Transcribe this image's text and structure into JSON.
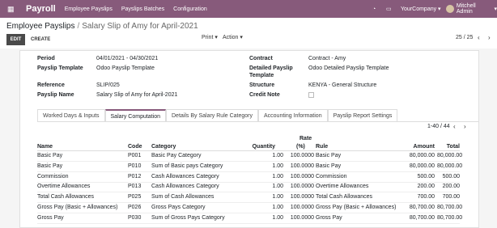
{
  "navbar": {
    "brand": "Payroll",
    "menu": [
      "Employee Payslips",
      "Payslips Batches",
      "Configuration"
    ],
    "company": "YourCompany",
    "user": "Mitchell Admin"
  },
  "breadcrumb": {
    "parent": "Employee Payslips",
    "current": "Salary Slip of Amy for April-2021"
  },
  "toolbar": {
    "edit": "EDIT",
    "create": "CREATE",
    "print": "Print",
    "action": "Action",
    "pager": "25 / 25"
  },
  "form": {
    "period_label": "Period",
    "period": "04/01/2021 - 04/30/2021",
    "template_label": "Payslip Template",
    "template": "Odoo Payslip Template",
    "reference_label": "Reference",
    "reference": "SLIP/025",
    "name_label": "Payslip Name",
    "name": "Salary Slip of Amy for April-2021",
    "contract_label": "Contract",
    "contract": "Contract - Amy",
    "detailed_label_1": "Detailed Payslip",
    "detailed_label_2": "Template",
    "detailed": "Odoo Detailed Payslip Template",
    "structure_label": "Structure",
    "structure": "KENYA - General Structure",
    "credit_label": "Credit Note"
  },
  "tabs": [
    "Worked Days & Inputs",
    "Salary Computation",
    "Details By Salary Rule Category",
    "Accounting Information",
    "Payslip Report Settings"
  ],
  "table": {
    "pager": "1-40 / 44",
    "headers": {
      "name": "Name",
      "code": "Code",
      "category": "Category",
      "quantity": "Quantity",
      "rate_1": "Rate",
      "rate_2": "(%)",
      "rule": "Rule",
      "amount": "Amount",
      "total": "Total"
    },
    "rows": [
      {
        "name": "Basic Pay",
        "code": "P001",
        "category": "Basic Pay Category",
        "quantity": "1.00",
        "rate": "100.0000",
        "rule": "Basic Pay",
        "amount": "80,000.00",
        "total": "80,000.00"
      },
      {
        "name": "Basic Pay",
        "code": "P010",
        "category": "Sum of Basic pays Category",
        "quantity": "1.00",
        "rate": "100.0000",
        "rule": "Basic Pay",
        "amount": "80,000.00",
        "total": "80,000.00"
      },
      {
        "name": "Commission",
        "code": "P012",
        "category": "Cash Allowances Category",
        "quantity": "1.00",
        "rate": "100.0000",
        "rule": "Commission",
        "amount": "500.00",
        "total": "500.00"
      },
      {
        "name": "Overtime Allowances",
        "code": "P013",
        "category": "Cash Allowances Category",
        "quantity": "1.00",
        "rate": "100.0000",
        "rule": "Overtime Allowances",
        "amount": "200.00",
        "total": "200.00"
      },
      {
        "name": "Total Cash Allowances",
        "code": "P025",
        "category": "Sum of Cash Allowances",
        "quantity": "1.00",
        "rate": "100.0000",
        "rule": "Total Cash Allowances",
        "amount": "700.00",
        "total": "700.00"
      },
      {
        "name": "Gross Pay (Basic + Allowances)",
        "code": "P026",
        "category": "Gross Pays Category",
        "quantity": "1.00",
        "rate": "100.0000",
        "rule": "Gross Pay (Basic + Allowances)",
        "amount": "80,700.00",
        "total": "80,700.00"
      },
      {
        "name": "Gross Pay",
        "code": "P030",
        "category": "Sum of Gross Pays Category",
        "quantity": "1.00",
        "rate": "100.0000",
        "rule": "Gross Pay",
        "amount": "80,700.00",
        "total": "80,700.00"
      }
    ]
  },
  "colors": {
    "navbar": "#875a7b",
    "edit_button": "#4a4a4a"
  }
}
